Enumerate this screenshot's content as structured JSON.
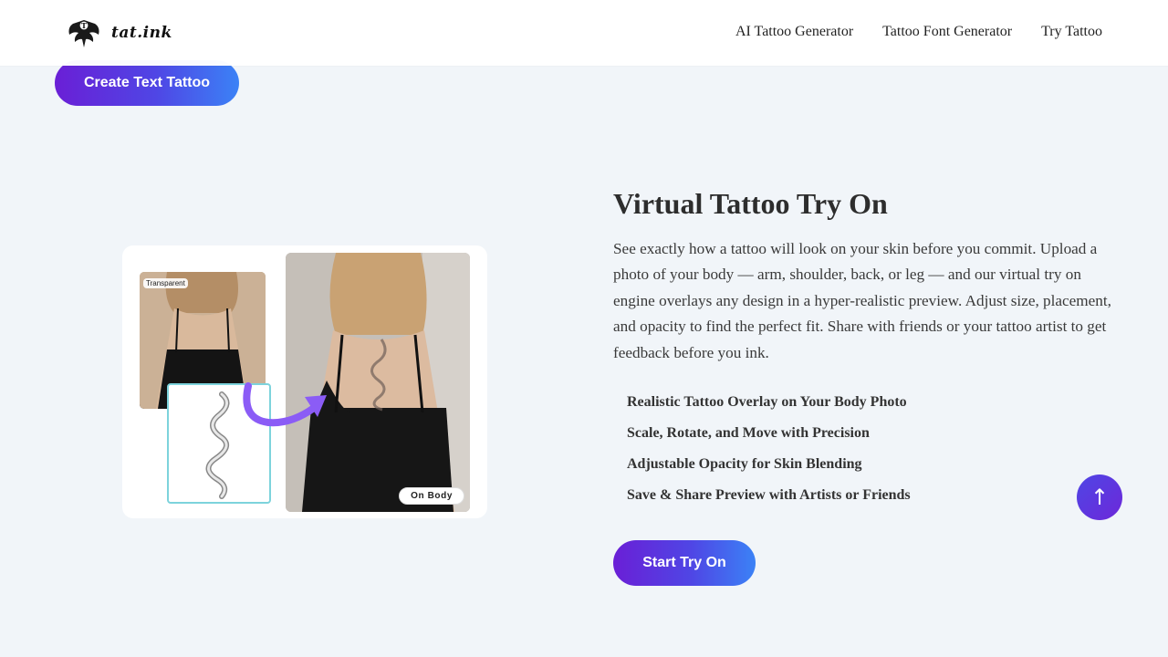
{
  "header": {
    "logo_text": "tat.ink",
    "nav": [
      "AI Tattoo Generator",
      "Tattoo Font Generator",
      "Try Tattoo"
    ]
  },
  "top_cta": {
    "label": "Create Text Tattoo"
  },
  "showcase": {
    "tag_left": "Transparent",
    "tag_right": "On Body"
  },
  "section": {
    "title": "Virtual Tattoo Try On",
    "description": "See exactly how a tattoo will look on your skin before you commit. Upload a photo of your body — arm, shoulder, back, or leg — and our virtual try on engine overlays any design in a hyper-realistic preview. Adjust size, placement, and opacity to find the perfect fit. Share with friends or your tattoo artist to get feedback before you ink.",
    "features": [
      "Realistic Tattoo Overlay on Your Body Photo",
      "Scale, Rotate, and Move with Precision",
      "Adjustable Opacity for Skin Blending",
      "Save & Share Preview with Artists or Friends"
    ],
    "cta_label": "Start Try On"
  },
  "scroll_top": {
    "icon": "arrow-up-icon",
    "glyph": "↑"
  },
  "colors": {
    "accent_start": "#6a1fd6",
    "accent_end": "#3b82f6",
    "background": "#f1f5f9"
  }
}
